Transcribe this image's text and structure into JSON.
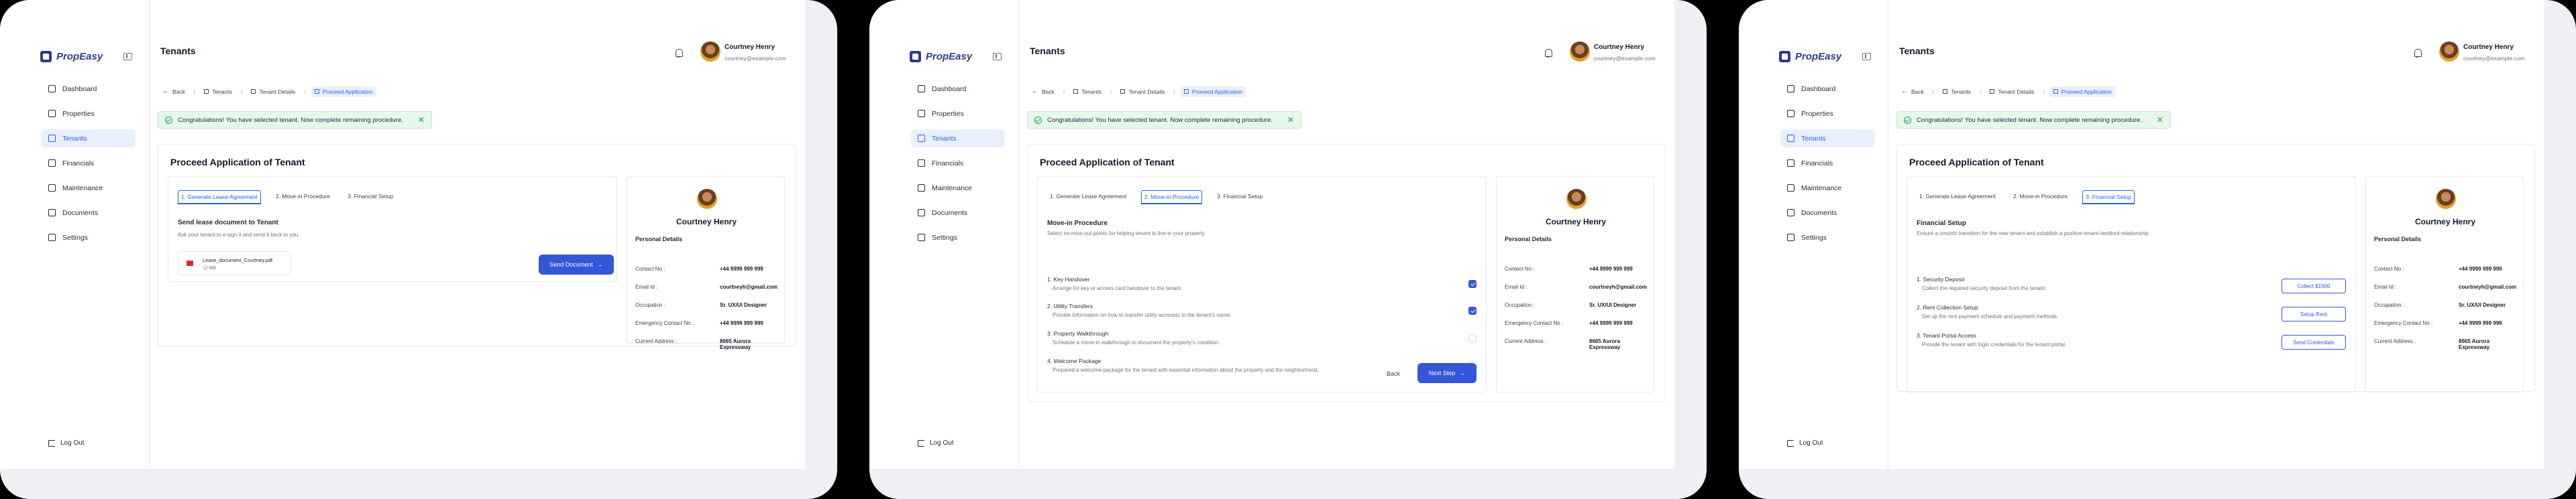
{
  "app": {
    "brand": "PropEasy"
  },
  "nav": {
    "items": [
      "Dashboard",
      "Properties",
      "Tenants",
      "Financials",
      "Maintenance",
      "Documents",
      "Settings"
    ],
    "active": "Tenants",
    "logout": "Log Out"
  },
  "header": {
    "title": "Tenants",
    "user_name": "Courtney Henry",
    "user_email": "courtney@example.com"
  },
  "breadcrumb": {
    "back": "Back",
    "items": [
      "Tenants",
      "Tenant Details",
      "Proceed Application"
    ]
  },
  "alert": {
    "text": "Congratulations! You have selected tenant. Now complete remaining procedure."
  },
  "card": {
    "title": "Proceed Application of Tenant"
  },
  "tabs": [
    "1. Generate Lease Agreement",
    "2. Move-in Procedure",
    "3. Financial Setup"
  ],
  "screen1": {
    "title": "Send lease document to Tenant",
    "subtitle": "Ask your tenant to e-sign it and send it back to you.",
    "file_name": "Lease_document_Courtney.pdf",
    "file_size": "12 MB",
    "send_button": "Send Document"
  },
  "screen2": {
    "title": "Move-in Procedure",
    "subtitle": "Select no-miss-out points for helping tenant to live in your property.",
    "steps": [
      {
        "title": "1. Key Handover",
        "desc": "Arrange for key or access card handover to the tenant.",
        "checked": true
      },
      {
        "title": "2. Utility Transfers",
        "desc": "Provide information on how to transfer utility accounts to the tenant's name.",
        "checked": true
      },
      {
        "title": "3. Property Walkthrough",
        "desc": "Schedule a move-in walkthrough to document the property's condition.",
        "checked": false
      },
      {
        "title": "4. Welcome Package",
        "desc": "Prepared a welcome package for the tenant with essential information about the property and the neighborhood.",
        "checked": false
      }
    ],
    "back": "Back",
    "next": "Next Step"
  },
  "screen3": {
    "title": "Financial Setup",
    "subtitle": "Ensure a smooth transition for the new tenant and establish a positive tenant-landlord relationship.",
    "steps": [
      {
        "title": "1. Security Deposit",
        "desc": "Collect the required security deposit from the tenant.",
        "action": "Collect $1500"
      },
      {
        "title": "2. Rent Collection Setup",
        "desc": "Set up the rent payment schedule and payment methods.",
        "action": "Setup Rent"
      },
      {
        "title": "3. Tenant Portal Access",
        "desc": "Provide the tenant with login credentials for the tenant portal.",
        "action": "Send Credentials"
      }
    ]
  },
  "profile": {
    "name": "Courtney Henry",
    "section": "Personal Details",
    "fields": [
      {
        "label": "Contact No :",
        "value": "+44 9999 999 999"
      },
      {
        "label": "Email Id :",
        "value": "courtneyh@gmail.com"
      },
      {
        "label": "Occupation :",
        "value": "Sr. UX/UI Designer"
      },
      {
        "label": "Emergency Contact No :",
        "value": "+44 9999 999 999"
      },
      {
        "label": "Current Address :",
        "value": "8665 Aurora Expressway"
      }
    ]
  },
  "colors": {
    "accent": "#3456d8",
    "brand": "#2f3a8f",
    "success_bg": "#e7f7ec"
  }
}
